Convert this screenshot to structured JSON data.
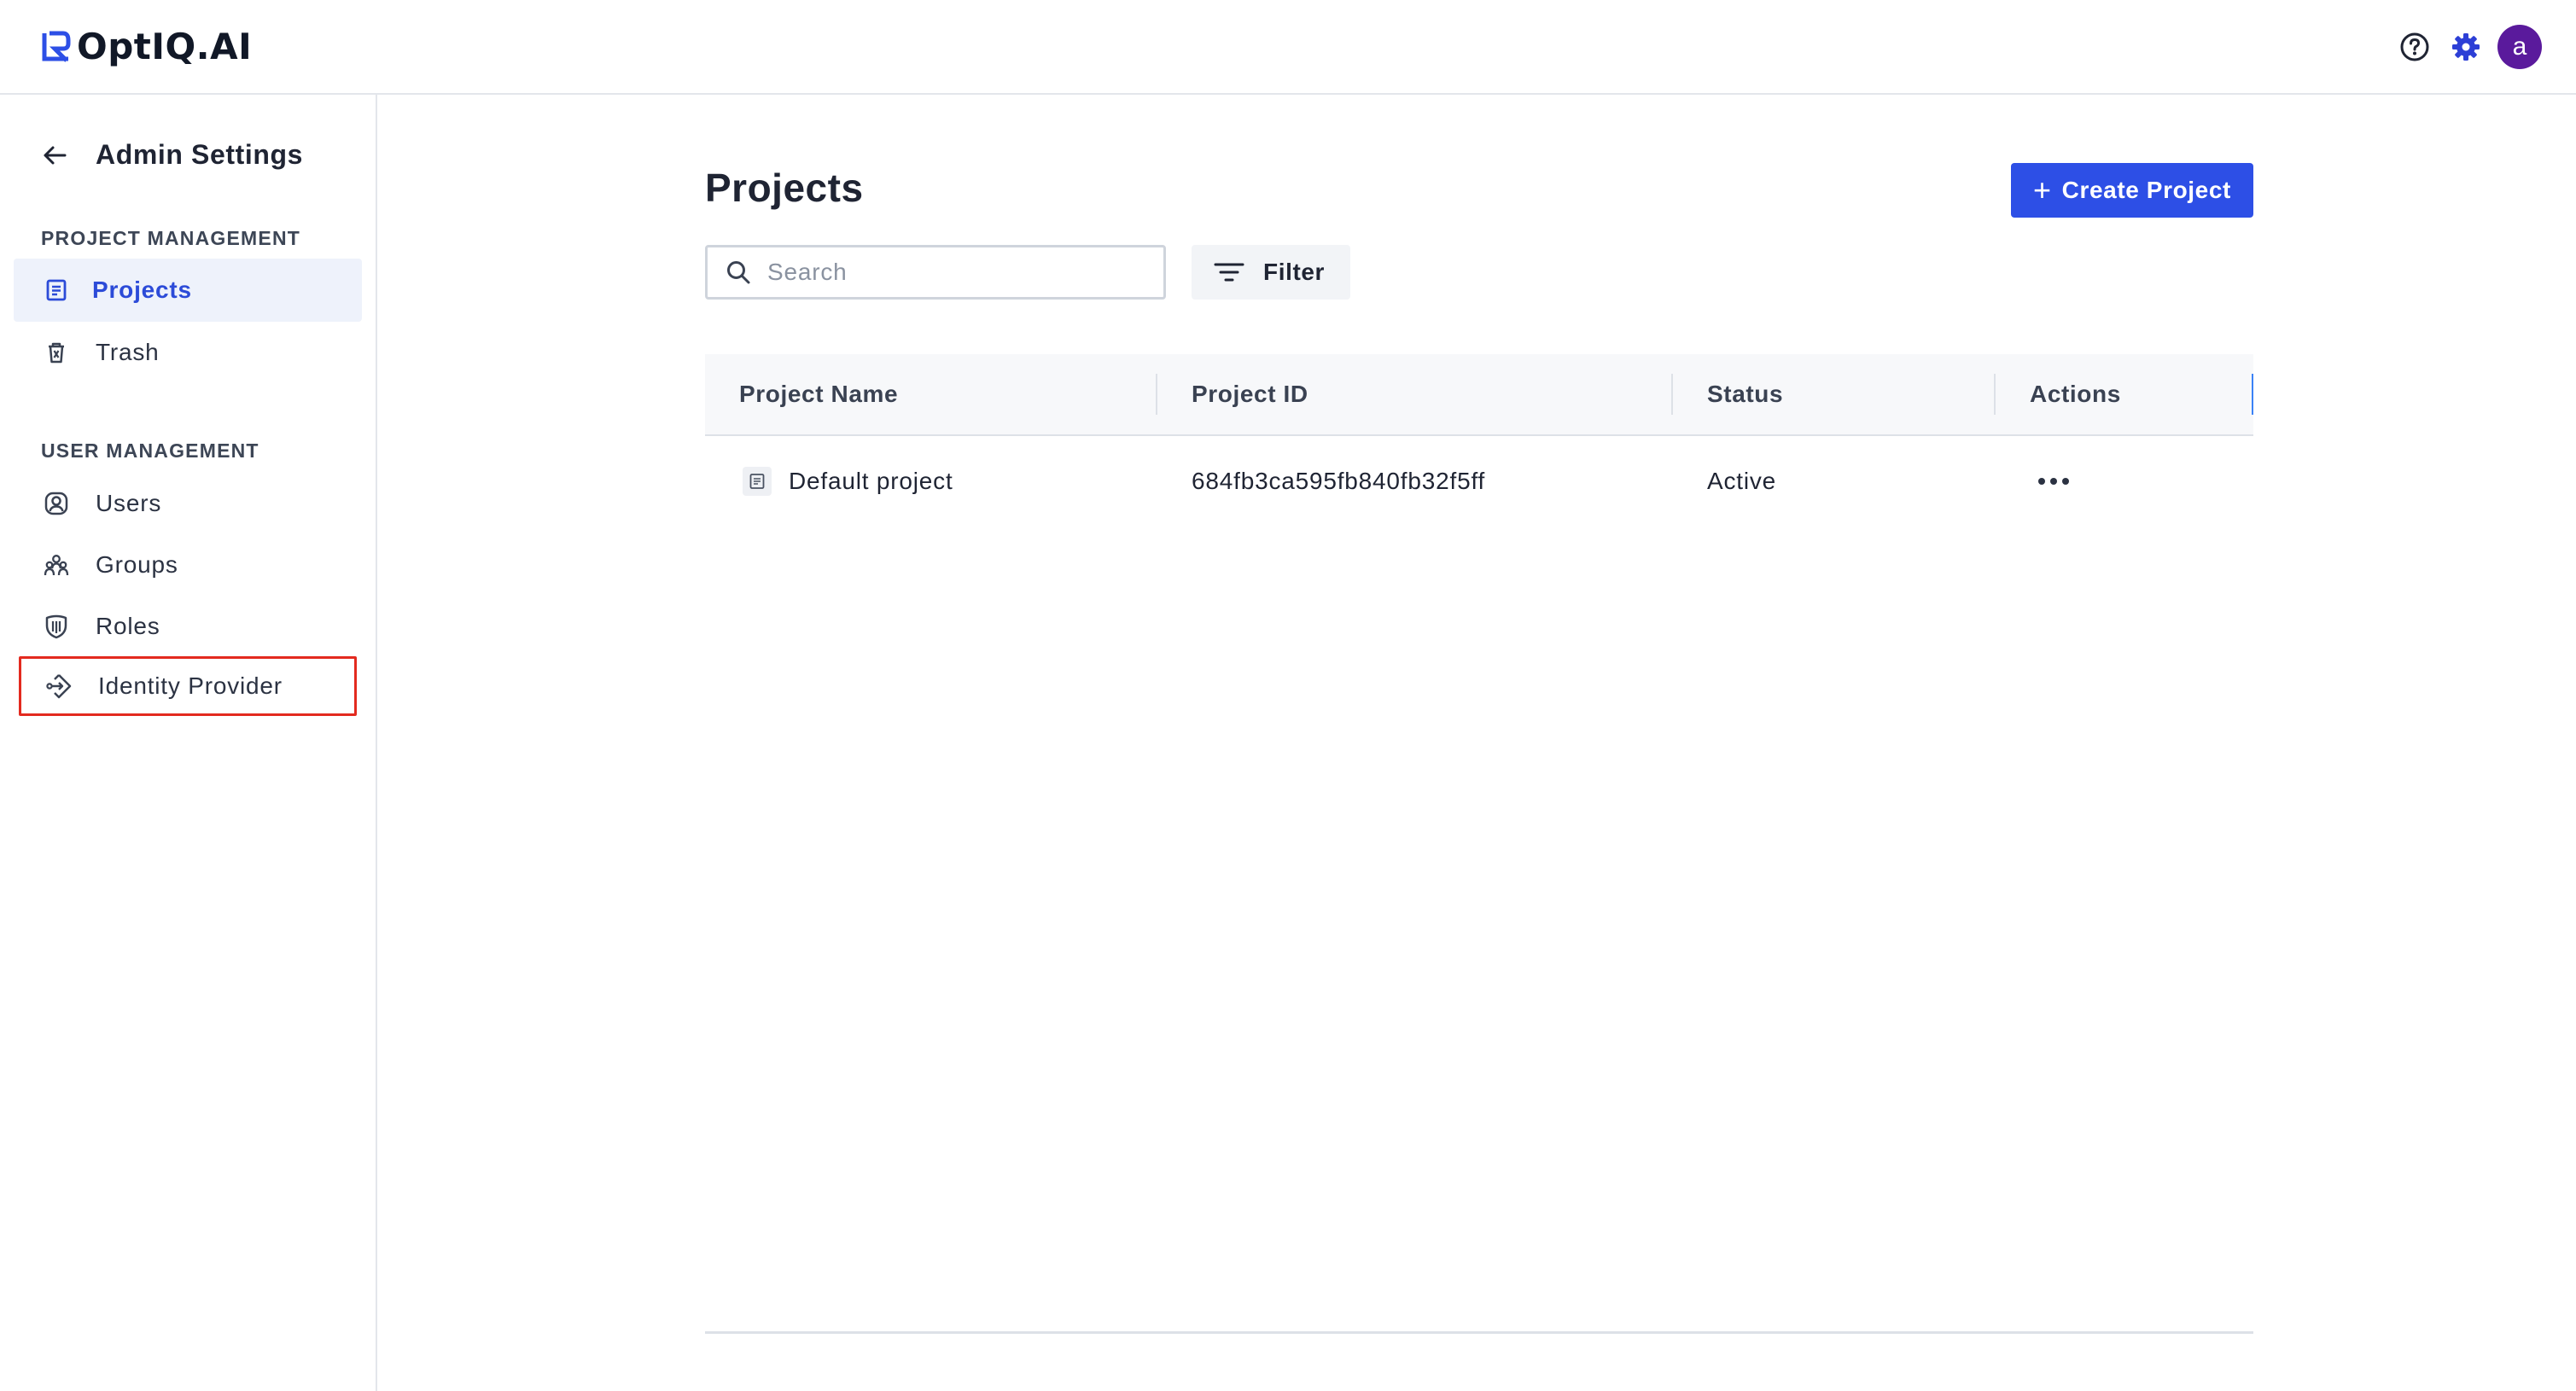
{
  "header": {
    "logo_text": "OptIQ.AI",
    "avatar_letter": "a",
    "icons": [
      "help-icon",
      "settings-gear-icon"
    ],
    "accent_color": "#2d4fe6"
  },
  "sidebar": {
    "back_title": "Admin Settings",
    "sections": [
      {
        "label": "PROJECT MANAGEMENT",
        "items": [
          {
            "label": "Projects",
            "icon": "project-icon",
            "active": true
          },
          {
            "label": "Trash",
            "icon": "trash-icon"
          }
        ]
      },
      {
        "label": "USER MANAGEMENT",
        "items": [
          {
            "label": "Users",
            "icon": "user-icon"
          },
          {
            "label": "Groups",
            "icon": "groups-icon"
          },
          {
            "label": "Roles",
            "icon": "roles-shield-icon"
          },
          {
            "label": "Identity Provider",
            "icon": "identity-provider-icon",
            "highlighted": true
          }
        ]
      }
    ]
  },
  "main": {
    "title": "Projects",
    "create_button_label": "Create Project",
    "search": {
      "placeholder": "Search",
      "value": ""
    },
    "filter_label": "Filter",
    "table": {
      "columns": [
        "Project Name",
        "Project ID",
        "Status",
        "Actions"
      ],
      "rows": [
        {
          "name": "Default project",
          "id": "684fb3ca595fb840fb32f5ff",
          "status": "Active"
        }
      ]
    }
  }
}
